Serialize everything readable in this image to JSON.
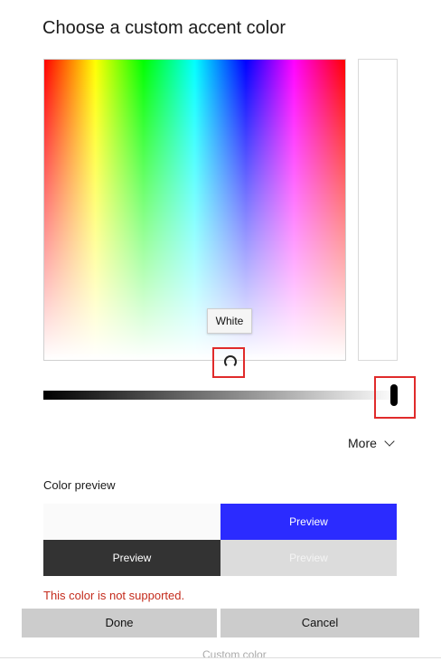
{
  "dialog": {
    "title": "Choose a custom accent color"
  },
  "picker": {
    "tooltip": "White"
  },
  "more": {
    "label": "More"
  },
  "preview": {
    "label": "Color preview",
    "tiles": [
      "Preview",
      "Preview",
      "Preview"
    ]
  },
  "error": {
    "message": "This color is not supported."
  },
  "buttons": {
    "done": "Done",
    "cancel": "Cancel"
  },
  "background": {
    "partial_text": "Custom color"
  },
  "colors": {
    "accent_preview": "#2b2bff",
    "dark_preview": "#333333",
    "light_preview": "#dcdcdc",
    "error": "#c42b1c",
    "highlight": "#e02b2b"
  }
}
